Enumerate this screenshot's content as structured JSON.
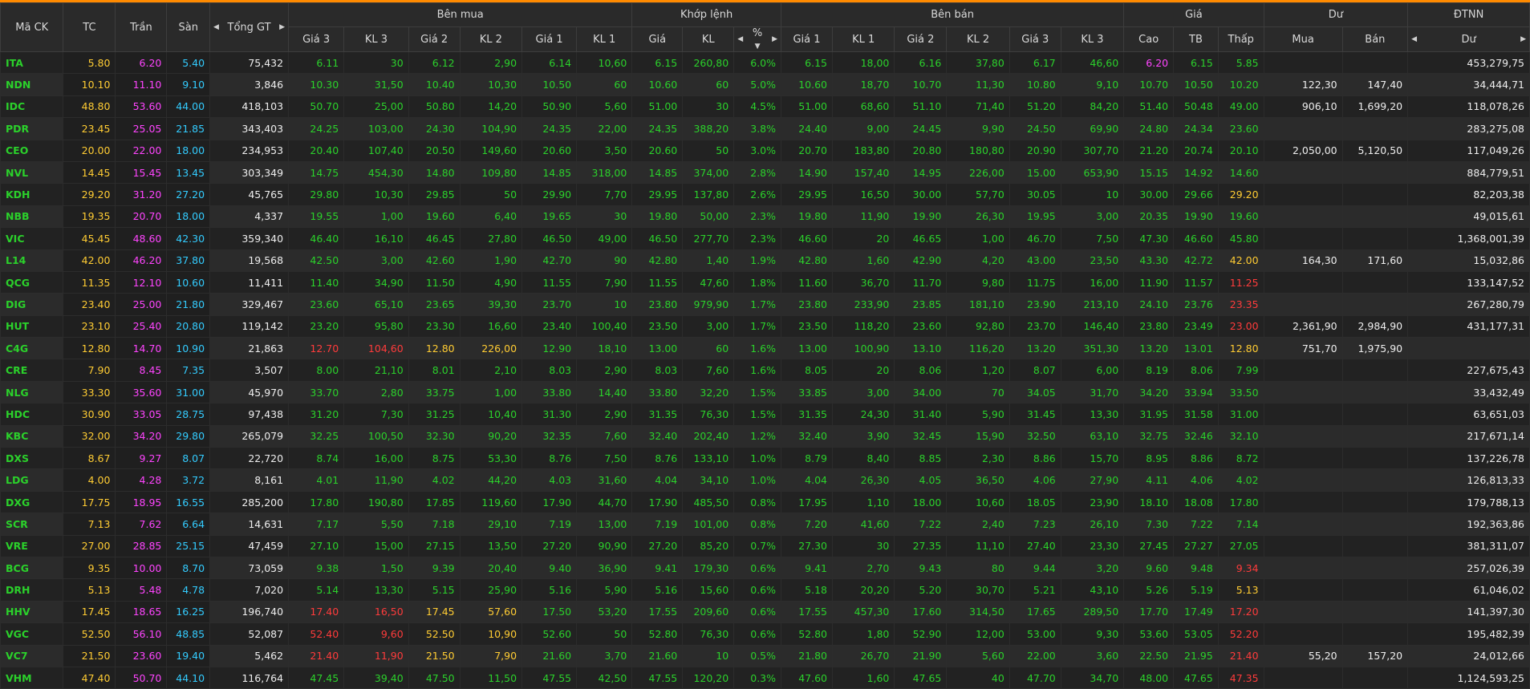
{
  "colors": {
    "up": "#2bd12b",
    "down": "#ff3b3b",
    "ref": "#ffcc33",
    "ceil": "#ff44ff",
    "floor": "#33ccff",
    "white": "#eeeeee"
  },
  "header": {
    "ma_ck": "Mã CK",
    "tc": "TC",
    "tran": "Trần",
    "san": "Sàn",
    "tong_gt": "Tổng GT",
    "ben_mua": "Bên mua",
    "khop_lenh": "Khớp lệnh",
    "ben_ban": "Bên bán",
    "gia": "Giá",
    "du": "Dư",
    "dtnn": "ĐTNN",
    "gia3": "Giá 3",
    "kl3": "KL 3",
    "gia2": "Giá 2",
    "kl2": "KL 2",
    "gia1": "Giá 1",
    "kl1": "KL 1",
    "k_gia": "Giá",
    "k_kl": "KL",
    "k_pct": "%",
    "s_gia1": "Giá 1",
    "s_kl1": "KL 1",
    "s_gia2": "Giá 2",
    "s_kl2": "KL 2",
    "s_gia3": "Giá 3",
    "s_kl3": "KL 3",
    "cao": "Cao",
    "tb": "TB",
    "thap": "Thấp",
    "mua": "Mua",
    "ban": "Bán",
    "ng_du": "Dư"
  },
  "rows": [
    {
      "sym": "ITA",
      "tc": "5.80",
      "tran": "6.20",
      "san": "5.40",
      "tgt": "75,432",
      "b3": "6.11",
      "bk3": "30",
      "b2": "6.12",
      "bk2": "2,90",
      "b1": "6.14",
      "bk1": "10,60",
      "mp": "6.15",
      "mv": "260,80",
      "pct": "6.0%",
      "s1": "6.15",
      "sk1": "18,00",
      "s2": "6.16",
      "sk2": "37,80",
      "s3": "6.17",
      "sk3": "46,60",
      "hi": "6.20",
      "avg": "6.15",
      "lo": "5.85",
      "mua": "",
      "ban": "",
      "du": "453,279,75",
      "c": "uuuuuuuuuuuuuuuuuuuuuuuuu",
      "hc": "c"
    },
    {
      "sym": "NDN",
      "tc": "10.10",
      "tran": "11.10",
      "san": "9.10",
      "tgt": "3,846",
      "b3": "10.30",
      "bk3": "31,50",
      "b2": "10.40",
      "bk2": "10,30",
      "b1": "10.50",
      "bk1": "60",
      "mp": "10.60",
      "mv": "60",
      "pct": "5.0%",
      "s1": "10.60",
      "sk1": "18,70",
      "s2": "10.70",
      "sk2": "11,30",
      "s3": "10.80",
      "sk3": "9,10",
      "hi": "10.70",
      "avg": "10.50",
      "lo": "10.20",
      "mua": "122,30",
      "ban": "147,40",
      "du": "34,444,71"
    },
    {
      "sym": "IDC",
      "tc": "48.80",
      "tran": "53.60",
      "san": "44.00",
      "tgt": "418,103",
      "b3": "50.70",
      "bk3": "25,00",
      "b2": "50.80",
      "bk2": "14,20",
      "b1": "50.90",
      "bk1": "5,60",
      "mp": "51.00",
      "mv": "30",
      "pct": "4.5%",
      "s1": "51.00",
      "sk1": "68,60",
      "s2": "51.10",
      "sk2": "71,40",
      "s3": "51.20",
      "sk3": "84,20",
      "hi": "51.40",
      "avg": "50.48",
      "lo": "49.00",
      "mua": "906,10",
      "ban": "1,699,20",
      "du": "118,078,26"
    },
    {
      "sym": "PDR",
      "tc": "23.45",
      "tran": "25.05",
      "san": "21.85",
      "tgt": "343,403",
      "b3": "24.25",
      "bk3": "103,00",
      "b2": "24.30",
      "bk2": "104,90",
      "b1": "24.35",
      "bk1": "22,00",
      "mp": "24.35",
      "mv": "388,20",
      "pct": "3.8%",
      "s1": "24.40",
      "sk1": "9,00",
      "s2": "24.45",
      "sk2": "9,90",
      "s3": "24.50",
      "sk3": "69,90",
      "hi": "24.80",
      "avg": "24.34",
      "lo": "23.60",
      "mua": "",
      "ban": "",
      "du": "283,275,08"
    },
    {
      "sym": "CEO",
      "tc": "20.00",
      "tran": "22.00",
      "san": "18.00",
      "tgt": "234,953",
      "b3": "20.40",
      "bk3": "107,40",
      "b2": "20.50",
      "bk2": "149,60",
      "b1": "20.60",
      "bk1": "3,50",
      "mp": "20.60",
      "mv": "50",
      "pct": "3.0%",
      "s1": "20.70",
      "sk1": "183,80",
      "s2": "20.80",
      "sk2": "180,80",
      "s3": "20.90",
      "sk3": "307,70",
      "hi": "21.20",
      "avg": "20.74",
      "lo": "20.10",
      "mua": "2,050,00",
      "ban": "5,120,50",
      "du": "117,049,26"
    },
    {
      "sym": "NVL",
      "tc": "14.45",
      "tran": "15.45",
      "san": "13.45",
      "tgt": "303,349",
      "b3": "14.75",
      "bk3": "454,30",
      "b2": "14.80",
      "bk2": "109,80",
      "b1": "14.85",
      "bk1": "318,00",
      "mp": "14.85",
      "mv": "374,00",
      "pct": "2.8%",
      "s1": "14.90",
      "sk1": "157,40",
      "s2": "14.95",
      "sk2": "226,00",
      "s3": "15.00",
      "sk3": "653,90",
      "hi": "15.15",
      "avg": "14.92",
      "lo": "14.60",
      "mua": "",
      "ban": "",
      "du": "884,779,51"
    },
    {
      "sym": "KDH",
      "tc": "29.20",
      "tran": "31.20",
      "san": "27.20",
      "tgt": "45,765",
      "b3": "29.80",
      "bk3": "10,30",
      "b2": "29.85",
      "bk2": "50",
      "b1": "29.90",
      "bk1": "7,70",
      "mp": "29.95",
      "mv": "137,80",
      "pct": "2.6%",
      "s1": "29.95",
      "sk1": "16,50",
      "s2": "30.00",
      "sk2": "57,70",
      "s3": "30.05",
      "sk3": "10",
      "hi": "30.00",
      "avg": "29.66",
      "lo": "29.20",
      "mua": "",
      "ban": "",
      "du": "82,203,38",
      "loc": "r"
    },
    {
      "sym": "NBB",
      "tc": "19.35",
      "tran": "20.70",
      "san": "18.00",
      "tgt": "4,337",
      "b3": "19.55",
      "bk3": "1,00",
      "b2": "19.60",
      "bk2": "6,40",
      "b1": "19.65",
      "bk1": "30",
      "mp": "19.80",
      "mv": "50,00",
      "pct": "2.3%",
      "s1": "19.80",
      "sk1": "11,90",
      "s2": "19.90",
      "sk2": "26,30",
      "s3": "19.95",
      "sk3": "3,00",
      "hi": "20.35",
      "avg": "19.90",
      "lo": "19.60",
      "mua": "",
      "ban": "",
      "du": "49,015,61"
    },
    {
      "sym": "VIC",
      "tc": "45.45",
      "tran": "48.60",
      "san": "42.30",
      "tgt": "359,340",
      "b3": "46.40",
      "bk3": "16,10",
      "b2": "46.45",
      "bk2": "27,80",
      "b1": "46.50",
      "bk1": "49,00",
      "mp": "46.50",
      "mv": "277,70",
      "pct": "2.3%",
      "s1": "46.60",
      "sk1": "20",
      "s2": "46.65",
      "sk2": "1,00",
      "s3": "46.70",
      "sk3": "7,50",
      "hi": "47.30",
      "avg": "46.60",
      "lo": "45.80",
      "mua": "",
      "ban": "",
      "du": "1,368,001,39"
    },
    {
      "sym": "L14",
      "tc": "42.00",
      "tran": "46.20",
      "san": "37.80",
      "tgt": "19,568",
      "b3": "42.50",
      "bk3": "3,00",
      "b2": "42.60",
      "bk2": "1,90",
      "b1": "42.70",
      "bk1": "90",
      "mp": "42.80",
      "mv": "1,40",
      "pct": "1.9%",
      "s1": "42.80",
      "sk1": "1,60",
      "s2": "42.90",
      "sk2": "4,20",
      "s3": "43.00",
      "sk3": "23,50",
      "hi": "43.30",
      "avg": "42.72",
      "lo": "42.00",
      "mua": "164,30",
      "ban": "171,60",
      "du": "15,032,86",
      "loc": "r"
    },
    {
      "sym": "QCG",
      "tc": "11.35",
      "tran": "12.10",
      "san": "10.60",
      "tgt": "11,411",
      "b3": "11.40",
      "bk3": "34,90",
      "b2": "11.50",
      "bk2": "4,90",
      "b1": "11.55",
      "bk1": "7,90",
      "mp": "11.55",
      "mv": "47,60",
      "pct": "1.8%",
      "s1": "11.60",
      "sk1": "36,70",
      "s2": "11.70",
      "sk2": "9,80",
      "s3": "11.75",
      "sk3": "16,00",
      "hi": "11.90",
      "avg": "11.57",
      "lo": "11.25",
      "mua": "",
      "ban": "",
      "du": "133,147,52",
      "loc": "d"
    },
    {
      "sym": "DIG",
      "tc": "23.40",
      "tran": "25.00",
      "san": "21.80",
      "tgt": "329,467",
      "b3": "23.60",
      "bk3": "65,10",
      "b2": "23.65",
      "bk2": "39,30",
      "b1": "23.70",
      "bk1": "10",
      "mp": "23.80",
      "mv": "979,90",
      "pct": "1.7%",
      "s1": "23.80",
      "sk1": "233,90",
      "s2": "23.85",
      "sk2": "181,10",
      "s3": "23.90",
      "sk3": "213,10",
      "hi": "24.10",
      "avg": "23.76",
      "lo": "23.35",
      "mua": "",
      "ban": "",
      "du": "267,280,79",
      "loc": "d"
    },
    {
      "sym": "HUT",
      "tc": "23.10",
      "tran": "25.40",
      "san": "20.80",
      "tgt": "119,142",
      "b3": "23.20",
      "bk3": "95,80",
      "b2": "23.30",
      "bk2": "16,60",
      "b1": "23.40",
      "bk1": "100,40",
      "mp": "23.50",
      "mv": "3,00",
      "pct": "1.7%",
      "s1": "23.50",
      "sk1": "118,20",
      "s2": "23.60",
      "sk2": "92,80",
      "s3": "23.70",
      "sk3": "146,40",
      "hi": "23.80",
      "avg": "23.49",
      "lo": "23.00",
      "mua": "2,361,90",
      "ban": "2,984,90",
      "du": "431,177,31",
      "loc": "d"
    },
    {
      "sym": "C4G",
      "tc": "12.80",
      "tran": "14.70",
      "san": "10.90",
      "tgt": "21,863",
      "b3": "12.70",
      "bk3": "104,60",
      "b2": "12.80",
      "bk2": "226,00",
      "b1": "12.90",
      "bk1": "18,10",
      "mp": "13.00",
      "mv": "60",
      "pct": "1.6%",
      "s1": "13.00",
      "sk1": "100,90",
      "s2": "13.10",
      "sk2": "116,20",
      "s3": "13.20",
      "sk3": "351,30",
      "hi": "13.20",
      "avg": "13.01",
      "lo": "12.80",
      "mua": "751,70",
      "ban": "1,975,90",
      "du": "",
      "b3c": "d",
      "b2c": "r",
      "loc": "r"
    },
    {
      "sym": "CRE",
      "tc": "7.90",
      "tran": "8.45",
      "san": "7.35",
      "tgt": "3,507",
      "b3": "8.00",
      "bk3": "21,10",
      "b2": "8.01",
      "bk2": "2,10",
      "b1": "8.03",
      "bk1": "2,90",
      "mp": "8.03",
      "mv": "7,60",
      "pct": "1.6%",
      "s1": "8.05",
      "sk1": "20",
      "s2": "8.06",
      "sk2": "1,20",
      "s3": "8.07",
      "sk3": "6,00",
      "hi": "8.19",
      "avg": "8.06",
      "lo": "7.99",
      "mua": "",
      "ban": "",
      "du": "227,675,43"
    },
    {
      "sym": "NLG",
      "tc": "33.30",
      "tran": "35.60",
      "san": "31.00",
      "tgt": "45,970",
      "b3": "33.70",
      "bk3": "2,80",
      "b2": "33.75",
      "bk2": "1,00",
      "b1": "33.80",
      "bk1": "14,40",
      "mp": "33.80",
      "mv": "32,20",
      "pct": "1.5%",
      "s1": "33.85",
      "sk1": "3,00",
      "s2": "34.00",
      "sk2": "70",
      "s3": "34.05",
      "sk3": "31,70",
      "hi": "34.20",
      "avg": "33.94",
      "lo": "33.50",
      "mua": "",
      "ban": "",
      "du": "33,432,49"
    },
    {
      "sym": "HDC",
      "tc": "30.90",
      "tran": "33.05",
      "san": "28.75",
      "tgt": "97,438",
      "b3": "31.20",
      "bk3": "7,30",
      "b2": "31.25",
      "bk2": "10,40",
      "b1": "31.30",
      "bk1": "2,90",
      "mp": "31.35",
      "mv": "76,30",
      "pct": "1.5%",
      "s1": "31.35",
      "sk1": "24,30",
      "s2": "31.40",
      "sk2": "5,90",
      "s3": "31.45",
      "sk3": "13,30",
      "hi": "31.95",
      "avg": "31.58",
      "lo": "31.00",
      "mua": "",
      "ban": "",
      "du": "63,651,03"
    },
    {
      "sym": "KBC",
      "tc": "32.00",
      "tran": "34.20",
      "san": "29.80",
      "tgt": "265,079",
      "b3": "32.25",
      "bk3": "100,50",
      "b2": "32.30",
      "bk2": "90,20",
      "b1": "32.35",
      "bk1": "7,60",
      "mp": "32.40",
      "mv": "202,40",
      "pct": "1.2%",
      "s1": "32.40",
      "sk1": "3,90",
      "s2": "32.45",
      "sk2": "15,90",
      "s3": "32.50",
      "sk3": "63,10",
      "hi": "32.75",
      "avg": "32.46",
      "lo": "32.10",
      "mua": "",
      "ban": "",
      "du": "217,671,14"
    },
    {
      "sym": "DXS",
      "tc": "8.67",
      "tran": "9.27",
      "san": "8.07",
      "tgt": "22,720",
      "b3": "8.74",
      "bk3": "16,00",
      "b2": "8.75",
      "bk2": "53,30",
      "b1": "8.76",
      "bk1": "7,50",
      "mp": "8.76",
      "mv": "133,10",
      "pct": "1.0%",
      "s1": "8.79",
      "sk1": "8,40",
      "s2": "8.85",
      "sk2": "2,30",
      "s3": "8.86",
      "sk3": "15,70",
      "hi": "8.95",
      "avg": "8.86",
      "lo": "8.72",
      "mua": "",
      "ban": "",
      "du": "137,226,78"
    },
    {
      "sym": "LDG",
      "tc": "4.00",
      "tran": "4.28",
      "san": "3.72",
      "tgt": "8,161",
      "b3": "4.01",
      "bk3": "11,90",
      "b2": "4.02",
      "bk2": "44,20",
      "b1": "4.03",
      "bk1": "31,60",
      "mp": "4.04",
      "mv": "34,10",
      "pct": "1.0%",
      "s1": "4.04",
      "sk1": "26,30",
      "s2": "4.05",
      "sk2": "36,50",
      "s3": "4.06",
      "sk3": "27,90",
      "hi": "4.11",
      "avg": "4.06",
      "lo": "4.02",
      "mua": "",
      "ban": "",
      "du": "126,813,33"
    },
    {
      "sym": "DXG",
      "tc": "17.75",
      "tran": "18.95",
      "san": "16.55",
      "tgt": "285,200",
      "b3": "17.80",
      "bk3": "190,80",
      "b2": "17.85",
      "bk2": "119,60",
      "b1": "17.90",
      "bk1": "44,70",
      "mp": "17.90",
      "mv": "485,50",
      "pct": "0.8%",
      "s1": "17.95",
      "sk1": "1,10",
      "s2": "18.00",
      "sk2": "10,60",
      "s3": "18.05",
      "sk3": "23,90",
      "hi": "18.10",
      "avg": "18.08",
      "lo": "17.80",
      "mua": "",
      "ban": "",
      "du": "179,788,13"
    },
    {
      "sym": "SCR",
      "tc": "7.13",
      "tran": "7.62",
      "san": "6.64",
      "tgt": "14,631",
      "b3": "7.17",
      "bk3": "5,50",
      "b2": "7.18",
      "bk2": "29,10",
      "b1": "7.19",
      "bk1": "13,00",
      "mp": "7.19",
      "mv": "101,00",
      "pct": "0.8%",
      "s1": "7.20",
      "sk1": "41,60",
      "s2": "7.22",
      "sk2": "2,40",
      "s3": "7.23",
      "sk3": "26,10",
      "hi": "7.30",
      "avg": "7.22",
      "lo": "7.14",
      "mua": "",
      "ban": "",
      "du": "192,363,86"
    },
    {
      "sym": "VRE",
      "tc": "27.00",
      "tran": "28.85",
      "san": "25.15",
      "tgt": "47,459",
      "b3": "27.10",
      "bk3": "15,00",
      "b2": "27.15",
      "bk2": "13,50",
      "b1": "27.20",
      "bk1": "90,90",
      "mp": "27.20",
      "mv": "85,20",
      "pct": "0.7%",
      "s1": "27.30",
      "sk1": "30",
      "s2": "27.35",
      "sk2": "11,10",
      "s3": "27.40",
      "sk3": "23,30",
      "hi": "27.45",
      "avg": "27.27",
      "lo": "27.05",
      "mua": "",
      "ban": "",
      "du": "381,311,07"
    },
    {
      "sym": "BCG",
      "tc": "9.35",
      "tran": "10.00",
      "san": "8.70",
      "tgt": "73,059",
      "b3": "9.38",
      "bk3": "1,50",
      "b2": "9.39",
      "bk2": "20,40",
      "b1": "9.40",
      "bk1": "36,90",
      "mp": "9.41",
      "mv": "179,30",
      "pct": "0.6%",
      "s1": "9.41",
      "sk1": "2,70",
      "s2": "9.43",
      "sk2": "80",
      "s3": "9.44",
      "sk3": "3,20",
      "hi": "9.60",
      "avg": "9.48",
      "lo": "9.34",
      "mua": "",
      "ban": "",
      "du": "257,026,39",
      "loc": "d"
    },
    {
      "sym": "DRH",
      "tc": "5.13",
      "tran": "5.48",
      "san": "4.78",
      "tgt": "7,020",
      "b3": "5.14",
      "bk3": "13,30",
      "b2": "5.15",
      "bk2": "25,90",
      "b1": "5.16",
      "bk1": "5,90",
      "mp": "5.16",
      "mv": "15,60",
      "pct": "0.6%",
      "s1": "5.18",
      "sk1": "20,20",
      "s2": "5.20",
      "sk2": "30,70",
      "s3": "5.21",
      "sk3": "43,10",
      "hi": "5.26",
      "avg": "5.19",
      "lo": "5.13",
      "mua": "",
      "ban": "",
      "du": "61,046,02",
      "loc": "r"
    },
    {
      "sym": "HHV",
      "tc": "17.45",
      "tran": "18.65",
      "san": "16.25",
      "tgt": "196,740",
      "b3": "17.40",
      "bk3": "16,50",
      "b2": "17.45",
      "bk2": "57,60",
      "b1": "17.50",
      "bk1": "53,20",
      "mp": "17.55",
      "mv": "209,60",
      "pct": "0.6%",
      "s1": "17.55",
      "sk1": "457,30",
      "s2": "17.60",
      "sk2": "314,50",
      "s3": "17.65",
      "sk3": "289,50",
      "hi": "17.70",
      "avg": "17.49",
      "lo": "17.20",
      "mua": "",
      "ban": "",
      "du": "141,397,30",
      "b3c": "d",
      "b2c": "r",
      "loc": "d"
    },
    {
      "sym": "VGC",
      "tc": "52.50",
      "tran": "56.10",
      "san": "48.85",
      "tgt": "52,087",
      "b3": "52.40",
      "bk3": "9,60",
      "b2": "52.50",
      "bk2": "10,90",
      "b1": "52.60",
      "bk1": "50",
      "mp": "52.80",
      "mv": "76,30",
      "pct": "0.6%",
      "s1": "52.80",
      "sk1": "1,80",
      "s2": "52.90",
      "sk2": "12,00",
      "s3": "53.00",
      "sk3": "9,30",
      "hi": "53.60",
      "avg": "53.05",
      "lo": "52.20",
      "mua": "",
      "ban": "",
      "du": "195,482,39",
      "b3c": "d",
      "b2c": "r",
      "loc": "d"
    },
    {
      "sym": "VC7",
      "tc": "21.50",
      "tran": "23.60",
      "san": "19.40",
      "tgt": "5,462",
      "b3": "21.40",
      "bk3": "11,90",
      "b2": "21.50",
      "bk2": "7,90",
      "b1": "21.60",
      "bk1": "3,70",
      "mp": "21.60",
      "mv": "10",
      "pct": "0.5%",
      "s1": "21.80",
      "sk1": "26,70",
      "s2": "21.90",
      "sk2": "5,60",
      "s3": "22.00",
      "sk3": "3,60",
      "hi": "22.50",
      "avg": "21.95",
      "lo": "21.40",
      "mua": "55,20",
      "ban": "157,20",
      "du": "24,012,66",
      "b3c": "d",
      "b2c": "r",
      "loc": "d"
    },
    {
      "sym": "VHM",
      "tc": "47.40",
      "tran": "50.70",
      "san": "44.10",
      "tgt": "116,764",
      "b3": "47.45",
      "bk3": "39,40",
      "b2": "47.50",
      "bk2": "11,50",
      "b1": "47.55",
      "bk1": "42,50",
      "mp": "47.55",
      "mv": "120,20",
      "pct": "0.3%",
      "s1": "47.60",
      "sk1": "1,60",
      "s2": "47.65",
      "sk2": "40",
      "s3": "47.70",
      "sk3": "34,70",
      "hi": "48.00",
      "avg": "47.65",
      "lo": "47.35",
      "mua": "",
      "ban": "",
      "du": "1,124,593,25",
      "loc": "d"
    }
  ]
}
